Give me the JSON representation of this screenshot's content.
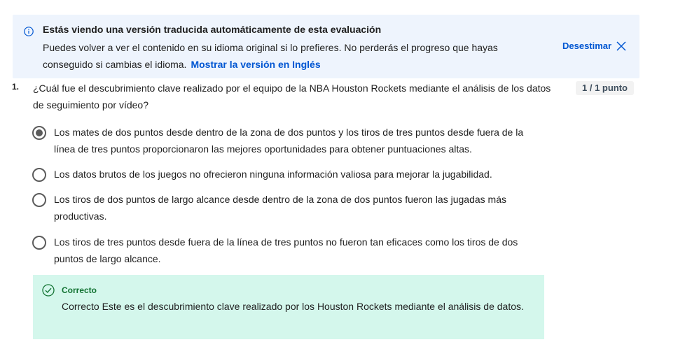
{
  "banner": {
    "title": "Estás viendo una versión traducida automáticamente de esta evaluación",
    "body": "Puedes volver a ver el contenido en su idioma original si lo prefieres. No perderás el progreso que hayas conseguido si cambias el idioma.",
    "link": "Mostrar la versión en Inglés",
    "dismiss": "Desestimar",
    "icon": "info-icon",
    "accent_color": "#0056d2",
    "background_color": "#eef4fd"
  },
  "question": {
    "number": "1.",
    "text": "¿Cuál fue el descubrimiento clave realizado por el equipo de la NBA Houston Rockets mediante el análisis de los datos de seguimiento por vídeo?",
    "points": "1 / 1 punto",
    "options": [
      {
        "label": "Los mates de dos puntos desde dentro de la zona de dos puntos y los tiros de tres puntos desde fuera de la línea de tres puntos proporcionaron las mejores oportunidades para obtener puntuaciones altas.",
        "selected": true
      },
      {
        "label": "Los datos brutos de los juegos no ofrecieron ninguna información valiosa para mejorar la jugabilidad.",
        "selected": false
      },
      {
        "label": "Los tiros de dos puntos de largo alcance desde dentro de la zona de dos puntos fueron las jugadas más productivas.",
        "selected": false
      },
      {
        "label": "Los tiros de tres puntos desde fuera de la línea de tres puntos no fueron tan eficaces como los tiros de dos puntos de largo alcance.",
        "selected": false
      }
    ]
  },
  "feedback": {
    "status": "Correcto",
    "text": "Correcto Este es el descubrimiento clave realizado por los Houston Rockets mediante el análisis de datos.",
    "icon": "check-circle-icon",
    "status_color": "#137333",
    "background_color": "#d4f7ec"
  }
}
